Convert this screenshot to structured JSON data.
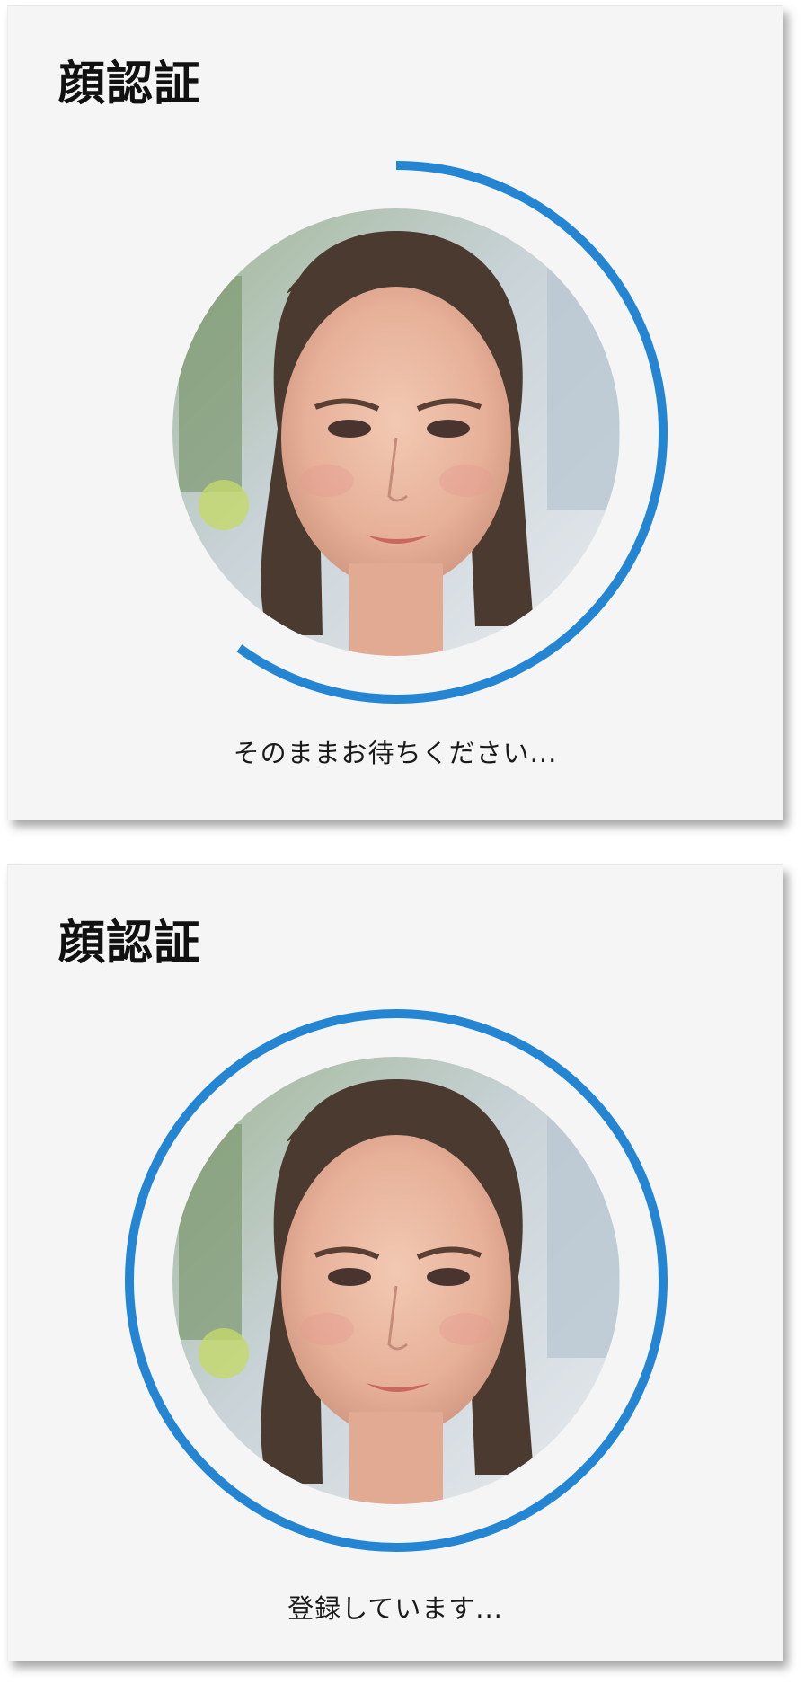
{
  "screens": [
    {
      "title": "顔認証",
      "status_text": "そのままお待ちください...",
      "progress": 0.6
    },
    {
      "title": "顔認証",
      "status_text": "登録しています...",
      "progress": 1.0
    }
  ],
  "colors": {
    "accent": "#2485d3",
    "card_background": "#f5f5f6"
  }
}
